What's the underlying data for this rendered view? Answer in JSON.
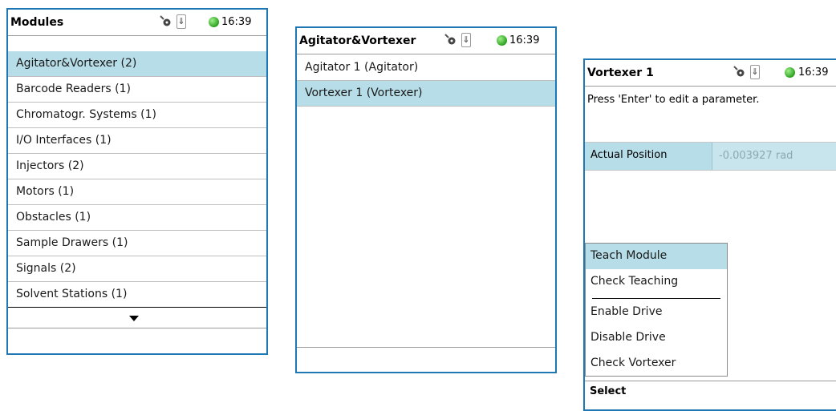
{
  "screen1": {
    "title": "Modules",
    "time": "16:39",
    "usb_glyph": "⇓",
    "items": [
      {
        "label": "Agitator&Vortexer (2)"
      },
      {
        "label": "Barcode Readers (1)"
      },
      {
        "label": "Chromatogr. Systems (1)"
      },
      {
        "label": "I/O Interfaces (1)"
      },
      {
        "label": "Injectors (2)"
      },
      {
        "label": "Motors (1)"
      },
      {
        "label": "Obstacles (1)"
      },
      {
        "label": "Sample Drawers (1)"
      },
      {
        "label": "Signals (2)"
      },
      {
        "label": "Solvent Stations (1)"
      }
    ],
    "selected_index": 0
  },
  "screen2": {
    "title": "Agitator&Vortexer",
    "time": "16:39",
    "usb_glyph": "⇓",
    "items": [
      {
        "label": "Agitator 1 (Agitator)"
      },
      {
        "label": "Vortexer 1 (Vortexer)"
      }
    ],
    "selected_index": 1
  },
  "screen3": {
    "title": "Vortexer 1",
    "time": "16:39",
    "usb_glyph": "⇓",
    "message": "Press 'Enter' to edit a parameter.",
    "parameter": {
      "label": "Actual Position",
      "value": "-0.003927 rad"
    },
    "menu": [
      {
        "label": "Teach Module"
      },
      {
        "label": "Check Teaching"
      },
      {
        "label": "Enable Drive"
      },
      {
        "label": "Disable Drive"
      },
      {
        "label": "Check Vortexer"
      }
    ],
    "softkey": "Select"
  },
  "colors": {
    "frame": "#1f78b4",
    "selection": "#b7dde8",
    "status_ok": "#2da11f"
  },
  "icons": [
    "tool-icon",
    "usb-icon",
    "status-ok-icon",
    "scroll-down-arrow-icon"
  ]
}
